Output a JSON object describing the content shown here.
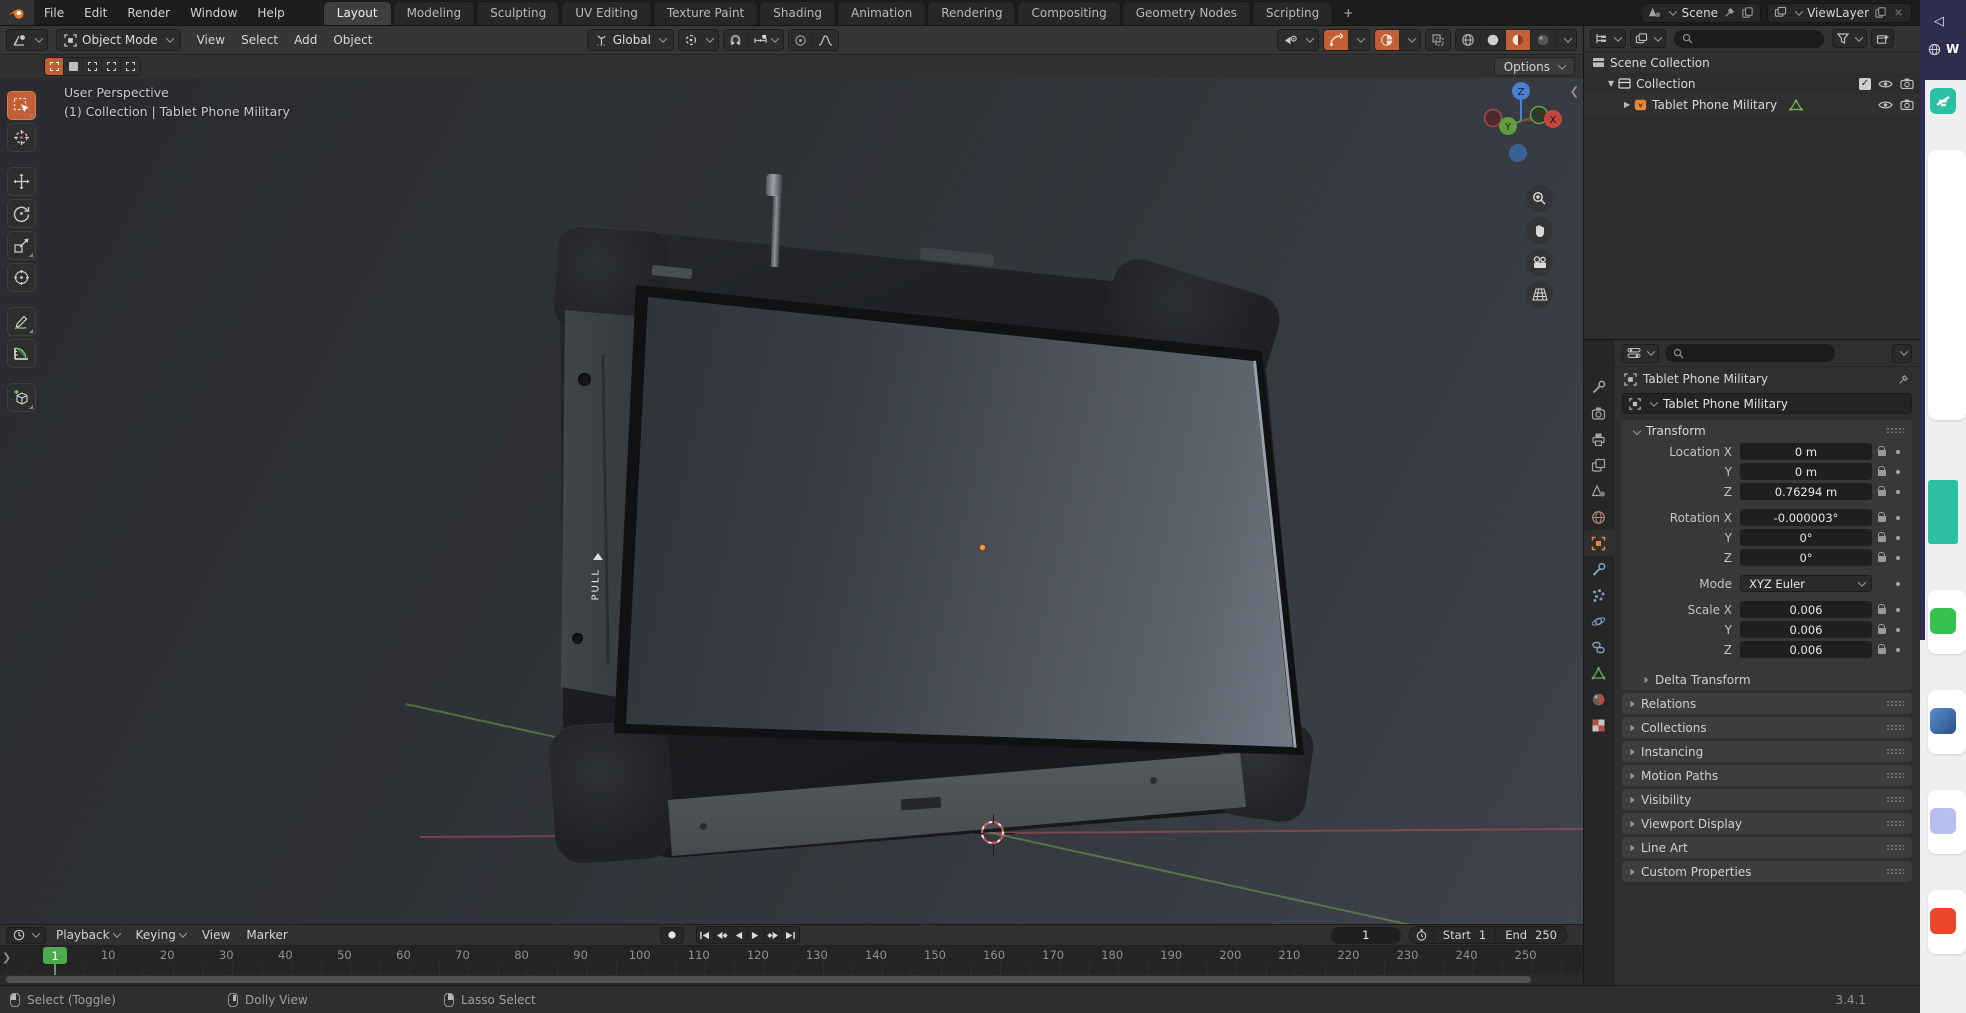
{
  "app": {
    "name": "Blender",
    "version": "3.4.1"
  },
  "colors": {
    "accent": "#c45f35",
    "playhead_green": "#4cab4c",
    "axis_red": "#a85360",
    "axis_green": "#6fa44e",
    "gizmo_blue": "#4a7fd1",
    "selection_orange": "#ff9c43"
  },
  "topbar": {
    "menus": [
      "File",
      "Edit",
      "Render",
      "Window",
      "Help"
    ],
    "workspaces": [
      "Layout",
      "Modeling",
      "Sculpting",
      "UV Editing",
      "Texture Paint",
      "Shading",
      "Animation",
      "Rendering",
      "Compositing",
      "Geometry Nodes",
      "Scripting"
    ],
    "active_workspace": "Layout",
    "new_workspace_label": "+",
    "scene_selector": {
      "label": "Scene"
    },
    "view_layer_selector": {
      "label": "ViewLayer"
    }
  },
  "viewport_header": {
    "mode_selector": "Object Mode",
    "menus": [
      "View",
      "Select",
      "Add",
      "Object"
    ],
    "transform_orientation": "Global",
    "options_button": "Options"
  },
  "tool_settings": {
    "select_modes": [
      "new",
      "extend",
      "subtract",
      "invert",
      "intersect"
    ],
    "active_mode": "new"
  },
  "toolbar": {
    "tools": [
      "select-box",
      "cursor",
      "move",
      "rotate",
      "scale",
      "transform",
      "annotate",
      "measure",
      "add-cube"
    ],
    "active_tool": "select-box"
  },
  "viewport": {
    "view_label": "User Perspective",
    "context_label": "(1) Collection | Tablet Phone Military",
    "axis_gizmo": [
      "Z",
      "Y",
      "X"
    ],
    "nav_buttons": [
      "zoom",
      "pan",
      "camera",
      "perspective"
    ],
    "model_label": "PULL"
  },
  "outliner": {
    "search_placeholder": "",
    "rows": [
      {
        "label": "Scene Collection",
        "icon": "scene-collection",
        "depth": 0,
        "expander": "none",
        "toggles": []
      },
      {
        "label": "Collection",
        "icon": "collection",
        "depth": 1,
        "expander": "open",
        "toggles": [
          "checkbox",
          "eye",
          "camera"
        ]
      },
      {
        "label": "Tablet Phone Military",
        "icon": "object-mesh",
        "depth": 2,
        "expander": "closed",
        "badge": "mesh-data",
        "toggles": [
          "eye",
          "camera"
        ]
      }
    ]
  },
  "properties": {
    "tabs": [
      "tool",
      "render",
      "output",
      "view-layer",
      "scene",
      "world",
      "object",
      "modifiers",
      "particles",
      "physics",
      "constraints",
      "data",
      "material",
      "texture"
    ],
    "active_tab": "object",
    "breadcrumb": "Tablet Phone Military",
    "name_field": "Tablet Phone Military",
    "transform_panel": {
      "title": "Transform",
      "rows": [
        {
          "label": "Location X",
          "value": "0 m",
          "lock": true,
          "dot": true,
          "gap": false
        },
        {
          "label": "Y",
          "value": "0 m",
          "lock": true,
          "dot": true,
          "gap": false
        },
        {
          "label": "Z",
          "value": "0.76294 m",
          "lock": true,
          "dot": true,
          "gap": false
        },
        {
          "label": "Rotation X",
          "value": "-0.000003°",
          "lock": true,
          "dot": true,
          "gap": true
        },
        {
          "label": "Y",
          "value": "0°",
          "lock": true,
          "dot": true,
          "gap": false
        },
        {
          "label": "Z",
          "value": "0°",
          "lock": true,
          "dot": true,
          "gap": false
        },
        {
          "label": "Mode",
          "value": "XYZ Euler",
          "dropdown": true,
          "dot": true,
          "gap": true
        },
        {
          "label": "Scale X",
          "value": "0.006",
          "lock": true,
          "dot": true,
          "gap": true
        },
        {
          "label": "Y",
          "value": "0.006",
          "lock": true,
          "dot": true,
          "gap": false
        },
        {
          "label": "Z",
          "value": "0.006",
          "lock": true,
          "dot": true,
          "gap": false
        }
      ],
      "sub_panel": "Delta Transform"
    },
    "collapsed_panels": [
      "Relations",
      "Collections",
      "Instancing",
      "Motion Paths",
      "Visibility",
      "Viewport Display",
      "Line Art",
      "Custom Properties"
    ]
  },
  "timeline": {
    "menus": [
      "Playback",
      "Keying",
      "View",
      "Marker"
    ],
    "current_frame": "1",
    "playhead_frame": 1,
    "frame_ticks": [
      10,
      20,
      30,
      40,
      50,
      60,
      70,
      80,
      90,
      100,
      110,
      120,
      130,
      140,
      150,
      160,
      170,
      180,
      190,
      200,
      210,
      220,
      230,
      240,
      250
    ],
    "start_label": "Start",
    "start_value": "1",
    "end_label": "End",
    "end_value": "250"
  },
  "status_bar": {
    "hints": [
      {
        "mouse": "left",
        "label": "Select (Toggle)"
      },
      {
        "mouse": "middle",
        "label": "Dolly View"
      },
      {
        "mouse": "right",
        "label": "Lasso Select"
      }
    ],
    "version": "3.4.1"
  },
  "side_window": {
    "back_label": "◁",
    "partial_text": "W"
  }
}
